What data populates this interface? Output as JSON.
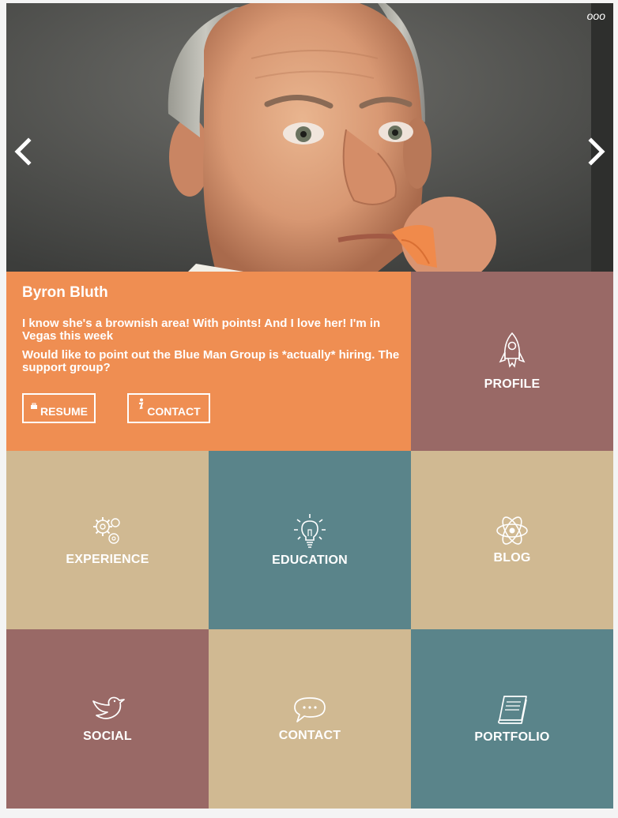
{
  "carousel": {
    "dots": "ooo",
    "prev_label": "<",
    "next_label": ">"
  },
  "profile_card": {
    "name": "Byron Bluth",
    "bio_line_1": "I know she's a brownish area! With points! And I love her! I'm in Vegas this week",
    "bio_line_2": "Would like to point out the Blue Man Group is *actually* hiring. The support group?",
    "resume_label": "RESUME",
    "contact_label": "CONTACT"
  },
  "tiles": {
    "profile": "PROFILE",
    "experience": "EXPERIENCE",
    "education": "EDUCATION",
    "blog": "BLOG",
    "social": "SOCIAL",
    "contact": "CONTACT",
    "portfolio": "PORTFOLIO"
  },
  "icons": {
    "profile": "rocket-icon",
    "experience": "gears-icon",
    "education": "lightbulb-icon",
    "blog": "atom-icon",
    "social": "bird-icon",
    "contact": "speech-bubble-icon",
    "portfolio": "book-icon"
  },
  "colors": {
    "orange": "#ef8e52",
    "mauve": "#996966",
    "tan": "#d0b992",
    "teal": "#5a848a"
  }
}
